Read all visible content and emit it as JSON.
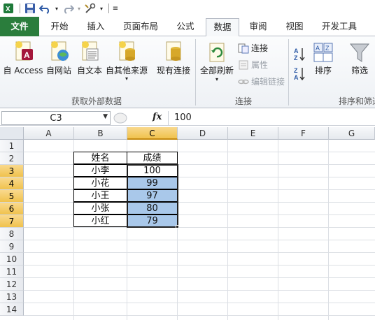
{
  "qat": {
    "icons": [
      "excel-logo-icon",
      "save-icon",
      "undo-icon",
      "redo-icon",
      "tools-icon",
      "customize-icon"
    ]
  },
  "tabs": [
    {
      "label": "文件",
      "active": false
    },
    {
      "label": "开始",
      "active": false
    },
    {
      "label": "插入",
      "active": false
    },
    {
      "label": "页面布局",
      "active": false
    },
    {
      "label": "公式",
      "active": false
    },
    {
      "label": "数据",
      "active": true
    },
    {
      "label": "审阅",
      "active": false
    },
    {
      "label": "视图",
      "active": false
    },
    {
      "label": "开发工具",
      "active": false
    }
  ],
  "ribbon": {
    "get_external": {
      "label": "获取外部数据",
      "buttons": [
        "自 Access",
        "自网站",
        "自文本",
        "自其他来源",
        "现有连接"
      ]
    },
    "connections": {
      "label": "连接",
      "refresh_all": "全部刷新",
      "connections": "连接",
      "properties": "属性",
      "edit_links": "编辑链接"
    },
    "sort_filter": {
      "label": "排序和筛选",
      "sort": "排序",
      "filter": "筛选"
    }
  },
  "formula_bar": {
    "name_box": "C3",
    "fx": "fx",
    "value": "100"
  },
  "sheet": {
    "columns": [
      "A",
      "B",
      "C",
      "D",
      "E",
      "F",
      "G"
    ],
    "selected_column": "C",
    "rows": [
      "1",
      "2",
      "3",
      "4",
      "5",
      "6",
      "7",
      "8",
      "9",
      "10",
      "11",
      "12",
      "13",
      "14"
    ],
    "selected_rows": [
      "3",
      "4",
      "5",
      "6",
      "7"
    ],
    "table": {
      "headers": [
        "姓名",
        "成绩"
      ],
      "data": [
        {
          "name": "小李",
          "score": "100"
        },
        {
          "name": "小花",
          "score": "99"
        },
        {
          "name": "小王",
          "score": "97"
        },
        {
          "name": "小张",
          "score": "80"
        },
        {
          "name": "小红",
          "score": "79"
        }
      ]
    }
  },
  "colors": {
    "file_tab": "#2a7d3c",
    "selection_fill": "#a9c8ea",
    "header_highlight": "#f0c24d"
  }
}
